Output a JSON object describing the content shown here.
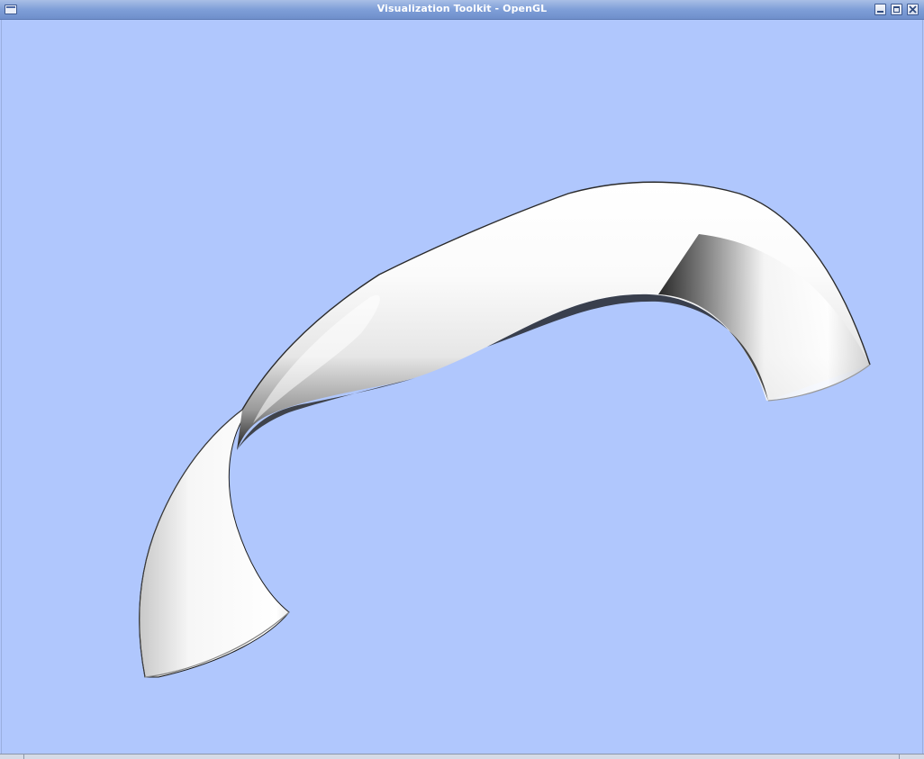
{
  "window": {
    "title": "Visualization Toolkit - OpenGL",
    "buttons": {
      "menu": "window-menu-icon",
      "minimize": "minimize-icon",
      "maximize": "maximize-icon",
      "close": "close-icon"
    }
  },
  "render": {
    "background_color": "#b0c7fd",
    "object": "shaded white tube surface"
  },
  "colors": {
    "titlebar": "#7f9fd8",
    "title_text": "#ffffff",
    "background": "#b0c7fd"
  }
}
